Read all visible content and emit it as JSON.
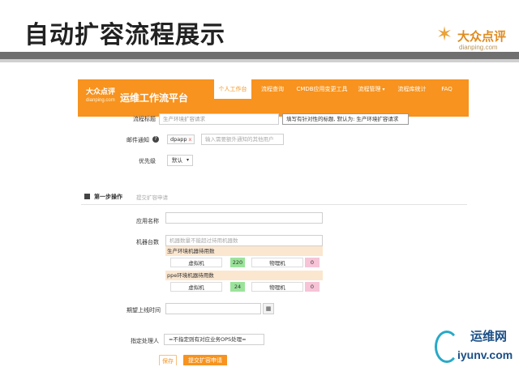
{
  "slide": {
    "title": "自动扩容流程展示",
    "brand_cn": "大众点评",
    "brand_en": "dianping.com",
    "brand_star": "✶"
  },
  "app": {
    "logo_cn": "大众点评",
    "logo_en": "dianping.com",
    "title": "运维工作流平台",
    "nav": [
      {
        "label": "个人工作台",
        "active": true
      },
      {
        "label": "流程查询"
      },
      {
        "label": "CMDB应用变更工具"
      },
      {
        "label": "流程管理"
      },
      {
        "label": "流程库统计"
      },
      {
        "label": "FAQ"
      }
    ],
    "nav_caret": "▾"
  },
  "form": {
    "process_title_label": "流程标题",
    "process_title_value": "生产环境扩容请求",
    "title_hint": "填写有针对性的标题, 默认为: 生产环境扩容请求",
    "email_label": "邮件通知",
    "help_glyph": "?",
    "email_tag": "dpapp",
    "tag_remove": "x",
    "email_placeholder": "输入需要额外通知的其他用户",
    "priority_label": "优先级",
    "priority_value": "默认",
    "select_arrow": "▾",
    "section_title": "第一步操作",
    "section_sub": "提交扩容申请",
    "app_name_label": "应用名称",
    "machine_count_label": "机器台数",
    "machine_count_placeholder": "机器数量不能超过待用机器数",
    "prod_heading": "生产环境机器待用数",
    "ppe_heading": "ppe环境机器待用数",
    "vm_label": "虚拟机",
    "pm_label": "物理机",
    "prod_vm": "220",
    "prod_pm": "0",
    "ppe_vm": "24",
    "ppe_pm": "0",
    "expected_label": "期望上线时间",
    "calendar_glyph": "▦",
    "assignee_label": "指定处理人",
    "assignee_value": "=不指定则有对应业务OPS处理=",
    "save_label": "保存",
    "submit_label": "提交扩容申请"
  },
  "watermark": {
    "cn": "运维网",
    "en": "iyunv.com"
  }
}
